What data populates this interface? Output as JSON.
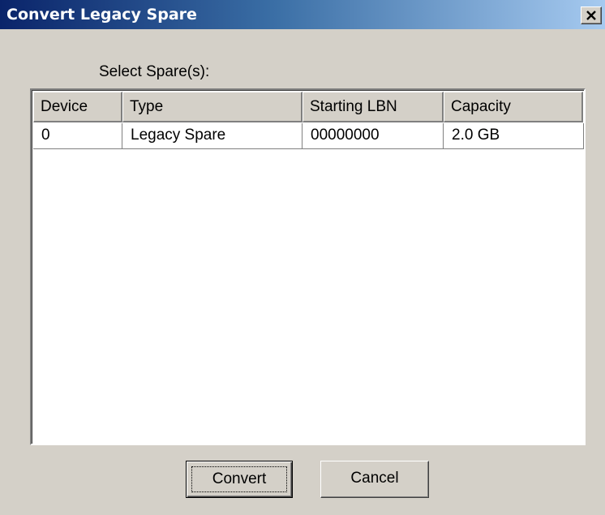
{
  "window": {
    "title": "Convert Legacy Spare"
  },
  "prompt": "Select Spare(s):",
  "table": {
    "columns": [
      "Device",
      "Type",
      "Starting LBN",
      "Capacity"
    ],
    "rows": [
      [
        "0",
        "Legacy Spare",
        "00000000",
        "2.0 GB"
      ]
    ]
  },
  "buttons": {
    "convert_label": "Convert",
    "cancel_label": "Cancel"
  },
  "icons": {
    "close": "close-icon"
  },
  "colors": {
    "titlebar_start": "#0a246a",
    "titlebar_end": "#a6caf0",
    "dialog_face": "#d4d0c8"
  }
}
